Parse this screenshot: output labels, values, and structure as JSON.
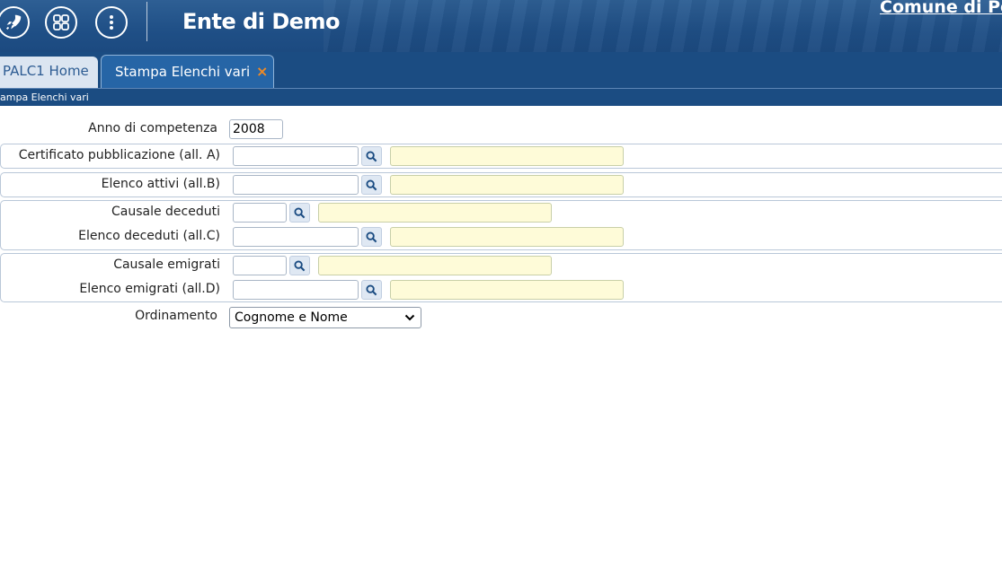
{
  "header": {
    "app_title": "Ente di Demo",
    "comune": "Comune di Pot",
    "icons": [
      "rocket-icon",
      "grid-icon",
      "more-vertical-icon"
    ]
  },
  "tabs": [
    {
      "label": "PALC1 Home",
      "active": false
    },
    {
      "label": "Stampa Elenchi vari",
      "active": true,
      "close": "×"
    }
  ],
  "breadcrumb": "ampa Elenchi vari",
  "form": {
    "anno_label": "Anno di competenza",
    "anno_value": "2008",
    "cert_label": "Certificato pubblicazione (all. A)",
    "attivi_label": "Elenco attivi (all.B)",
    "causale_deceduti_label": "Causale deceduti",
    "deceduti_label": "Elenco deceduti (all.C)",
    "causale_emigrati_label": "Causale emigrati",
    "emigrati_label": "Elenco emigrati (all.D)",
    "ordinamento_label": "Ordinamento",
    "ordinamento_value": "Cognome e Nome"
  },
  "colors": {
    "header_bg": "#1f4f86",
    "tab_active": "#2665a6",
    "close_accent": "#f08a24",
    "desc_field_bg": "#fefbd8"
  }
}
